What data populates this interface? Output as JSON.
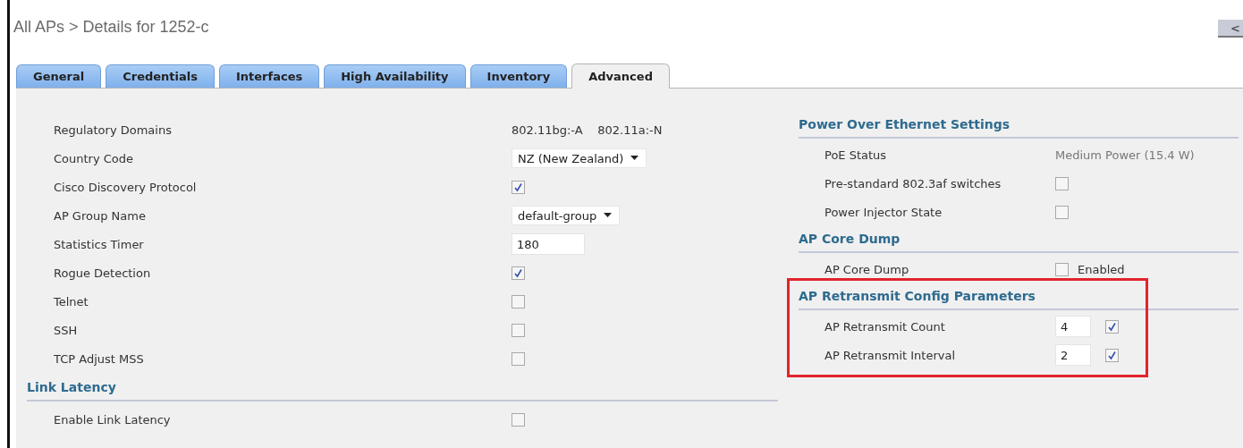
{
  "breadcrumb": "All APs > Details for 1252-c",
  "back_button": {
    "label": "<"
  },
  "tabs": [
    {
      "label": "General",
      "selected": false
    },
    {
      "label": "Credentials",
      "selected": false
    },
    {
      "label": "Interfaces",
      "selected": false
    },
    {
      "label": "High Availability",
      "selected": false
    },
    {
      "label": "Inventory",
      "selected": false
    },
    {
      "label": "Advanced",
      "selected": true
    }
  ],
  "left_rows": [
    {
      "kind": "text",
      "label": "Regulatory Domains",
      "value": "802.11bg:-A    802.11a:-N"
    },
    {
      "kind": "select",
      "label": "Country Code",
      "value": "NZ (New Zealand)"
    },
    {
      "kind": "checkbox",
      "label": "Cisco Discovery Protocol",
      "checked": true
    },
    {
      "kind": "select",
      "label": "AP Group Name",
      "value": "default-group"
    },
    {
      "kind": "input",
      "label": "Statistics Timer",
      "value": "180"
    },
    {
      "kind": "checkbox",
      "label": "Rogue Detection",
      "checked": true
    },
    {
      "kind": "checkbox",
      "label": "Telnet",
      "checked": false
    },
    {
      "kind": "checkbox",
      "label": "SSH",
      "checked": false
    },
    {
      "kind": "checkbox",
      "label": "TCP Adjust MSS",
      "checked": false
    }
  ],
  "link_latency": {
    "title": "Link Latency",
    "rows": [
      {
        "kind": "checkbox",
        "label": "Enable Link Latency",
        "checked": false
      }
    ]
  },
  "right_sections": [
    {
      "title": "Power Over Ethernet Settings",
      "rows": [
        {
          "kind": "text",
          "label": "PoE Status",
          "value": "Medium Power (15.4 W)"
        },
        {
          "kind": "checkbox",
          "label": "Pre-standard 802.3af switches",
          "checked": false
        },
        {
          "kind": "checkbox",
          "label": "Power Injector State",
          "checked": false
        }
      ]
    },
    {
      "title": "AP Core Dump",
      "rows": [
        {
          "kind": "checkbox",
          "label": "AP Core Dump",
          "checked": false,
          "option": "Enabled"
        }
      ]
    },
    {
      "title": "AP Retransmit Config Parameters",
      "highlighted": true,
      "rows": [
        {
          "kind": "input-checkbox",
          "label": "AP Retransmit Count",
          "value": "4",
          "checked": true
        },
        {
          "kind": "input-checkbox",
          "label": "AP Retransmit Interval",
          "value": "2",
          "checked": true
        }
      ]
    }
  ]
}
